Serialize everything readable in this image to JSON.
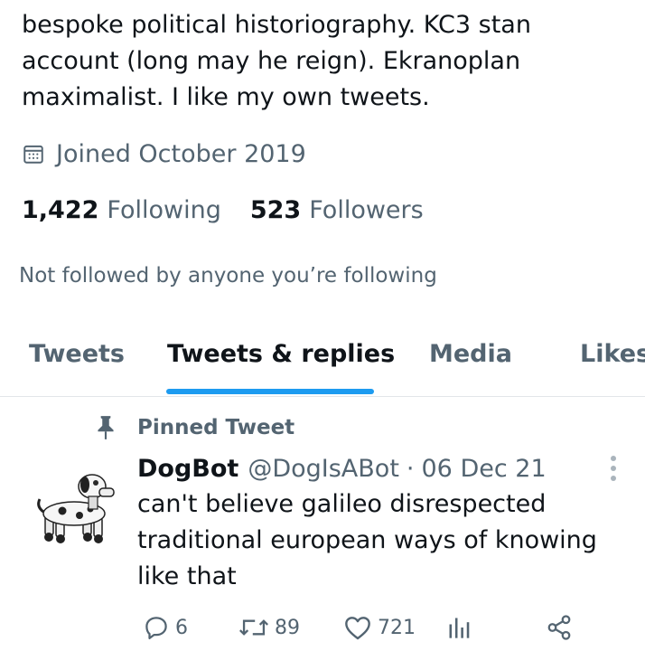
{
  "profile": {
    "bio": "bespoke political historiography. KC3 stan\naccount (long may he reign). Ekranoplan\nmaximalist. I like my own tweets.",
    "joined": "Joined October 2019",
    "following_count": "1,422",
    "following_label": "Following",
    "followers_count": "523",
    "followers_label": "Followers",
    "not_followed": "Not followed by anyone you’re following"
  },
  "tabs": [
    {
      "label": "Tweets",
      "active": false
    },
    {
      "label": "Tweets & replies",
      "active": true
    },
    {
      "label": "Media",
      "active": false
    },
    {
      "label": "Likes",
      "active": false
    }
  ],
  "tweet": {
    "pinned_label": "Pinned Tweet",
    "author_name": "DogBot",
    "author_handle": "@DogIsABot",
    "separator": "·",
    "date": "06 Dec 21",
    "text": "can't believe galileo disrespected\ntraditional european ways of knowing\nlike that",
    "replies": "6",
    "retweets": "89",
    "likes": "721"
  },
  "icons": {
    "calendar": "calendar-icon",
    "pin": "pin-icon",
    "more": "more-options-icon",
    "reply": "reply-icon",
    "retweet": "retweet-icon",
    "like": "heart-icon",
    "views": "analytics-icon",
    "share": "share-icon"
  },
  "colors": {
    "accent": "#1d9bf0",
    "secondary_text": "#536471",
    "primary_text": "#0f1419"
  }
}
